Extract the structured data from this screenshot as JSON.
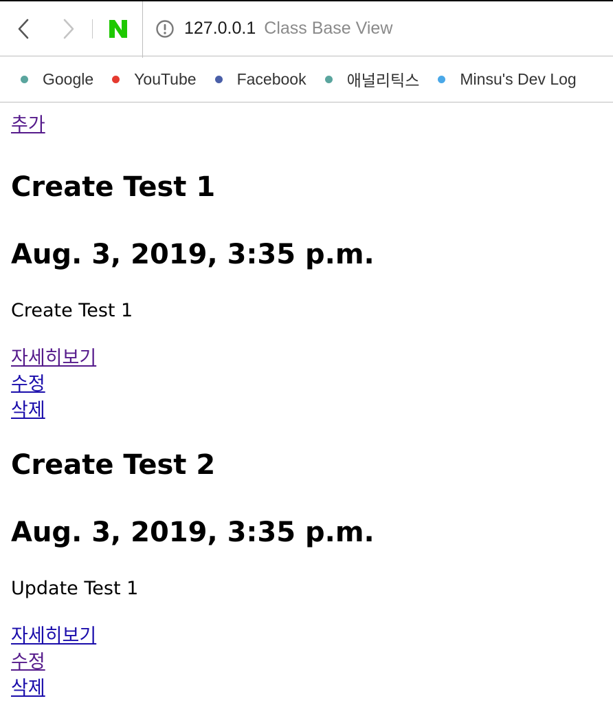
{
  "browser": {
    "url_host": "127.0.0.1",
    "page_title": "Class Base View",
    "logo_letter": "N",
    "logo_color": "#1ec800"
  },
  "bookmarks": [
    {
      "label": "Google",
      "color": "#5aa59e"
    },
    {
      "label": "YouTube",
      "color": "#e53a2f"
    },
    {
      "label": "Facebook",
      "color": "#4a5fa8"
    },
    {
      "label": "애널리틱스",
      "color": "#5aa59e"
    },
    {
      "label": "Minsu's Dev Log",
      "color": "#4aa8e8"
    }
  ],
  "add_link": "추가",
  "posts": [
    {
      "title": "Create Test 1",
      "date": "Aug. 3, 2019, 3:35 p.m.",
      "body": "Create Test 1",
      "detail": "자세히보기",
      "edit": "수정",
      "delete": "삭제"
    },
    {
      "title": "Create Test 2",
      "date": "Aug. 3, 2019, 3:35 p.m.",
      "body": "Update Test 1",
      "detail": "자세히보기",
      "edit": "수정",
      "delete": "삭제"
    }
  ]
}
